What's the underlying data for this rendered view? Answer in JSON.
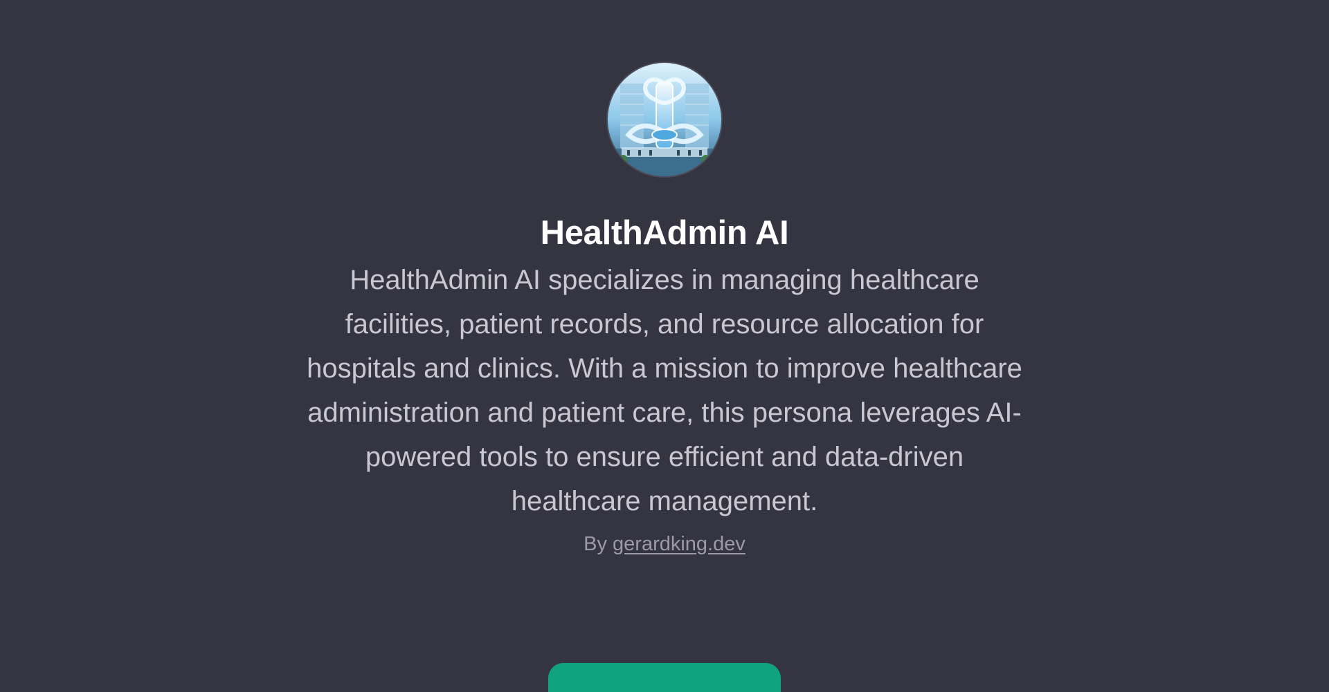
{
  "gpt": {
    "avatar_icon": "hospital-building-logo-icon",
    "title": "HealthAdmin AI",
    "description": "HealthAdmin AI specializes in managing healthcare facilities, patient records, and resource allocation for hospitals and clinics. With a mission to improve healthcare administration and patient care, this persona leverages AI-powered tools to ensure efficient and data-driven healthcare management.",
    "byline_prefix": "By",
    "author": "gerardking.dev"
  },
  "actions": {
    "start_label": ""
  },
  "colors": {
    "background": "#353441",
    "title": "#ffffff",
    "description": "#c9c8d2",
    "byline": "#9b9aa6",
    "accent": "#10a37f"
  }
}
